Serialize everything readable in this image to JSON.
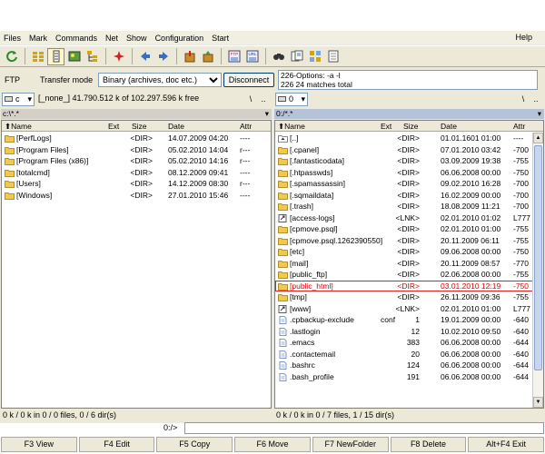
{
  "menu": [
    "Files",
    "Mark",
    "Commands",
    "Net",
    "Show",
    "Configuration",
    "Start"
  ],
  "menu_help": "Help",
  "toolbar_icons": [
    "refresh-icon",
    "brief-view-icon",
    "full-view-icon",
    "thumbnail-view-icon",
    "tree-view-icon",
    "invert-selection-icon",
    "back-icon",
    "forward-icon",
    "pack-files-icon",
    "unpack-files-icon",
    "ftp-connect-icon",
    "url-connect-icon",
    "find-files-icon",
    "multi-rename-icon",
    "sync-dirs-icon",
    "notepad-icon"
  ],
  "ftp": {
    "label": "FTP",
    "transfer_label": "Transfer mode",
    "transfer_mode": "Binary (archives, doc etc.)",
    "disconnect_label": "Disconnect",
    "log_line1": "226-Options: -a -l",
    "log_line2": "226 24 matches total"
  },
  "left_drive": {
    "drive": "c",
    "info": "[_none_]  41.790.512 k of 102.297.596 k free",
    "btn1": "\\",
    "btn2": "..",
    "path": "c:\\*.*"
  },
  "right_drive": {
    "drive": "0",
    "btn1": "\\",
    "btn2": "..",
    "path": "0:/*.*"
  },
  "columns": {
    "name": "Name",
    "ext": "Ext",
    "size": "Size",
    "date": "Date",
    "attr": "Attr"
  },
  "left_files": [
    {
      "name": "[PerfLogs]",
      "ext": "",
      "size": "<DIR>",
      "date": "14.07.2009 04:20",
      "attr": "----",
      "icon": "folder-icon"
    },
    {
      "name": "[Program Files]",
      "ext": "",
      "size": "<DIR>",
      "date": "05.02.2010 14:04",
      "attr": "r---",
      "icon": "folder-icon"
    },
    {
      "name": "[Program Files (x86)]",
      "ext": "",
      "size": "<DIR>",
      "date": "05.02.2010 14:16",
      "attr": "r---",
      "icon": "folder-icon"
    },
    {
      "name": "[totalcmd]",
      "ext": "",
      "size": "<DIR>",
      "date": "08.12.2009 09:41",
      "attr": "----",
      "icon": "folder-icon"
    },
    {
      "name": "[Users]",
      "ext": "",
      "size": "<DIR>",
      "date": "14.12.2009 08:30",
      "attr": "r---",
      "icon": "folder-icon"
    },
    {
      "name": "[Windows]",
      "ext": "",
      "size": "<DIR>",
      "date": "27.01.2010 15:46",
      "attr": "----",
      "icon": "folder-icon"
    }
  ],
  "right_files": [
    {
      "name": "[..]",
      "ext": "",
      "size": "<DIR>",
      "date": "01.01.1601 01:00",
      "attr": "----",
      "icon": "up-dir-icon"
    },
    {
      "name": "[.cpanel]",
      "ext": "",
      "size": "<DIR>",
      "date": "07.01.2010 03:42",
      "attr": "-700",
      "icon": "folder-icon"
    },
    {
      "name": "[.fantasticodata]",
      "ext": "",
      "size": "<DIR>",
      "date": "03.09.2009 19:38",
      "attr": "-755",
      "icon": "folder-icon"
    },
    {
      "name": "[.htpasswds]",
      "ext": "",
      "size": "<DIR>",
      "date": "06.06.2008 00:00",
      "attr": "-750",
      "icon": "folder-icon"
    },
    {
      "name": "[.spamassassin]",
      "ext": "",
      "size": "<DIR>",
      "date": "09.02.2010 16:28",
      "attr": "-700",
      "icon": "folder-icon"
    },
    {
      "name": "[.sqmaildata]",
      "ext": "",
      "size": "<DIR>",
      "date": "16.02.2009 00:00",
      "attr": "-700",
      "icon": "folder-icon"
    },
    {
      "name": "[.trash]",
      "ext": "",
      "size": "<DIR>",
      "date": "18.08.2009 11:21",
      "attr": "-700",
      "icon": "folder-icon"
    },
    {
      "name": "[access-logs]",
      "ext": "",
      "size": "<LNK>",
      "date": "02.01.2010 01:02",
      "attr": "L777",
      "icon": "link-icon"
    },
    {
      "name": "[cpmove.psql]",
      "ext": "",
      "size": "<DIR>",
      "date": "02.01.2010 01:00",
      "attr": "-755",
      "icon": "folder-icon"
    },
    {
      "name": "[cpmove.psql.1262390550]",
      "ext": "",
      "size": "<DIR>",
      "date": "20.11.2009 06:11",
      "attr": "-755",
      "icon": "folder-icon"
    },
    {
      "name": "[etc]",
      "ext": "",
      "size": "<DIR>",
      "date": "09.06.2008 00:00",
      "attr": "-750",
      "icon": "folder-icon"
    },
    {
      "name": "[mail]",
      "ext": "",
      "size": "<DIR>",
      "date": "20.11.2009 08:57",
      "attr": "-770",
      "icon": "folder-icon"
    },
    {
      "name": "[public_ftp]",
      "ext": "",
      "size": "<DIR>",
      "date": "02.06.2008 00:00",
      "attr": "-755",
      "icon": "folder-icon"
    },
    {
      "name": "[public_html]",
      "ext": "",
      "size": "<DIR>",
      "date": "03.01.2010 12:19",
      "attr": "-750",
      "icon": "folder-icon",
      "cursor": true
    },
    {
      "name": "[tmp]",
      "ext": "",
      "size": "<DIR>",
      "date": "26.11.2009 09:36",
      "attr": "-755",
      "icon": "folder-icon"
    },
    {
      "name": "[www]",
      "ext": "",
      "size": "<LNK>",
      "date": "02.01.2010 01:00",
      "attr": "L777",
      "icon": "link-icon"
    },
    {
      "name": ".cpbackup-exclude",
      "ext": "conf",
      "size": "1",
      "date": "19.01.2009 00:00",
      "attr": "-640",
      "icon": "file-icon"
    },
    {
      "name": ".lastlogin",
      "ext": "",
      "size": "12",
      "date": "10.02.2010 09:50",
      "attr": "-640",
      "icon": "file-icon"
    },
    {
      "name": ".emacs",
      "ext": "",
      "size": "383",
      "date": "06.06.2008 00:00",
      "attr": "-644",
      "icon": "file-icon"
    },
    {
      "name": ".contactemail",
      "ext": "",
      "size": "20",
      "date": "06.06.2008 00:00",
      "attr": "-640",
      "icon": "file-icon"
    },
    {
      "name": ".bashrc",
      "ext": "",
      "size": "124",
      "date": "06.06.2008 00:00",
      "attr": "-644",
      "icon": "file-icon"
    },
    {
      "name": ".bash_profile",
      "ext": "",
      "size": "191",
      "date": "06.06.2008 00:00",
      "attr": "-644",
      "icon": "file-icon"
    }
  ],
  "left_status": "0 k / 0 k in 0 / 0 files, 0 / 6 dir(s)",
  "right_status": "0 k / 0 k in 0 / 7 files, 1 / 15 dir(s)",
  "cmd_label": "0:/>",
  "fkeys": [
    "F3 View",
    "F4 Edit",
    "F5 Copy",
    "F6 Move",
    "F7 NewFolder",
    "F8 Delete",
    "Alt+F4 Exit"
  ],
  "colors": {
    "folder": "#f2c94c",
    "cursor_text": "#e00000",
    "active_path": "#b6c3d6"
  }
}
